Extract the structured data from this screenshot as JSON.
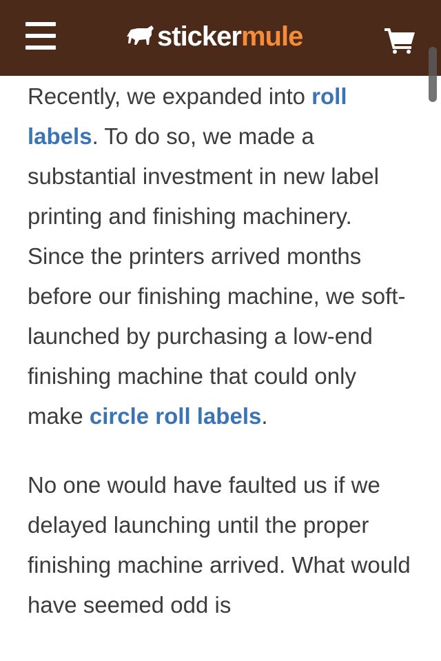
{
  "header": {
    "menu_icon": "hamburger-menu-icon",
    "logo": {
      "icon": "mule-icon",
      "part1": "sticker",
      "part2": "mule"
    },
    "cart_icon": "shopping-cart-icon",
    "colors": {
      "background": "#4b2a1a",
      "logo_accent": "#f58c3c"
    }
  },
  "article": {
    "paragraph1": {
      "seg1": "Recently, we expanded into ",
      "link1": "roll labels",
      "seg2": ". To do so, we made a substantial investment in new label printing and finishing machinery. Since the printers arrived months before our finishing machine, we soft-launched by purchasing a low-end finishing machine that could only make ",
      "link2": "circle roll labels",
      "seg3": "."
    },
    "paragraph2": {
      "text": "No one would have faulted us if we delayed launching until the proper finishing machine arrived. What would have seemed odd is"
    },
    "link_color": "#3b74b4"
  }
}
